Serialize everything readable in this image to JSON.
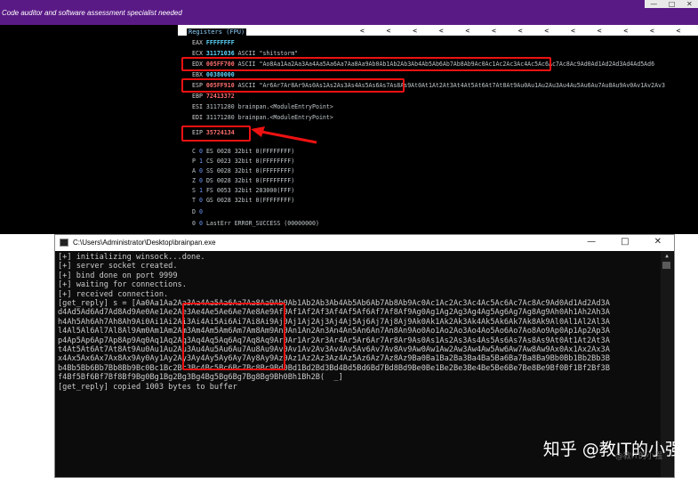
{
  "banner": {
    "title": "Code auditor and software assessment specialist needed",
    "controls": [
      "—",
      "□",
      "✕"
    ]
  },
  "registers": {
    "header": "Registers (FPU)",
    "arrows": "< < < < < < < < < < < < < < < < < < <",
    "rows": [
      {
        "name": "EAX",
        "value": "FFFFFFFF",
        "comment": ""
      },
      {
        "name": "ECX",
        "value": "31171036",
        "comment": "ASCII \"shitstorm\""
      },
      {
        "name": "EDX",
        "value": "005FF700",
        "comment": "ASCII \"Ao8Aa1Aa2Aa3Aa4Aa5Aa6Aa7Aa8Aa9Ab0Ab1Ab2Ab3Ab4Ab5Ab6Ab7Ab8Ab9Ac0Ac1Ac2Ac3Ac4Ac5Ac6Ac7Ac8Ac9Ad0Ad1Ad2Ad3Ad4Ad5Ad6"
      },
      {
        "name": "EBX",
        "value": "00380000",
        "comment": ""
      },
      {
        "name": "ESP",
        "value": "005FF910",
        "comment": "ASCII \"Ar6Ar7Ar8Ar9As0As1As2As3As4As5As6As7As8As9At0At1At2At3At4At5At6At7At8At9Au0Au1Au2Au3Au4Au5Au6Au7Au8Au9Av0Av1Av2Av3"
      },
      {
        "name": "EBP",
        "value": "72413372",
        "comment": ""
      },
      {
        "name": "ESI",
        "value": "31171280",
        "comment": "brainpan.<ModuleEntryPoint>"
      },
      {
        "name": "EDI",
        "value": "31171280",
        "comment": "brainpan.<ModuleEntryPoint>"
      },
      {
        "name": "EIP",
        "value": "35724134",
        "comment": ""
      }
    ],
    "flags": [
      {
        "f": "C",
        "v": "0",
        "seg": "ES 0028 32bit 0(FFFFFFFF)"
      },
      {
        "f": "P",
        "v": "1",
        "seg": "CS 0023 32bit 0(FFFFFFFF)"
      },
      {
        "f": "A",
        "v": "0",
        "seg": "SS 0028 32bit 0(FFFFFFFF)"
      },
      {
        "f": "Z",
        "v": "0",
        "seg": "DS 0028 32bit 0(FFFFFFFF)"
      },
      {
        "f": "S",
        "v": "1",
        "seg": "FS 0053 32bit 283000(FFF)"
      },
      {
        "f": "T",
        "v": "0",
        "seg": "GS 0028 32bit 0(FFFFFFFF)"
      },
      {
        "f": "D",
        "v": "0",
        "seg": ""
      },
      {
        "f": "0",
        "v": "0",
        "seg": "LastErr ERROR_SUCCESS (00000000)"
      }
    ]
  },
  "console": {
    "path": "C:\\Users\\Administrator\\Desktop\\brainpan.exe",
    "buttons": [
      "—",
      "□",
      "✕"
    ],
    "lines": [
      "[+] initializing winsock...done.",
      "[+] server socket created.",
      "[+] bind done on port 9999",
      "[+] waiting for connections.",
      "[+] received connection.",
      "[get_reply] s = [Aa0Aa1Aa2Aa3Aa4Aa5Aa6Aa7Aa8Aa9Ab0Ab1Ab2Ab3Ab4Ab5Ab6Ab7Ab8Ab9Ac0Ac1Ac2Ac3Ac4Ac5Ac6Ac7Ac8Ac9Ad0Ad1Ad2Ad3A",
      "d4Ad5Ad6Ad7Ad8Ad9Ae0Ae1Ae2Ae3Ae4Ae5Ae6Ae7Ae8Ae9Af0Af1Af2Af3Af4Af5Af6Af7Af8Af9Ag0Ag1Ag2Ag3Ag4Ag5Ag6Ag7Ag8Ag9Ah0Ah1Ah2Ah3A",
      "h4Ah5Ah6Ah7Ah8Ah9Ai0Ai1Ai2Ai3Ai4Ai5Ai6Ai7Ai8Ai9Aj0Aj1Aj2Aj3Aj4Aj5Aj6Aj7Aj8Aj9Ak0Ak1Ak2Ak3Ak4Ak5Ak6Ak7Ak8Ak9Al0Al1Al2Al3A",
      "l4Al5Al6Al7Al8Al9Am0Am1Am2Am3Am4Am5Am6Am7Am8Am9An0An1An2An3An4An5An6An7An8An9Ao0Ao1Ao2Ao3Ao4Ao5Ao6Ao7Ao8Ao9Ap0Ap1Ap2Ap3A",
      "p4Ap5Ap6Ap7Ap8Ap9Aq0Aq1Aq2Aq3Aq4Aq5Aq6Aq7Aq8Aq9Ar0Ar1Ar2Ar3Ar4Ar5Ar6Ar7Ar8Ar9As0As1As2As3As4As5As6As7As8As9At0At1At2At3A",
      "t4At5At6At7At8At9Au0Au1Au2Au3Au4Au5Au6Au7Au8Au9Av0Av1Av2Av3Av4Av5Av6Av7Av8Av9Aw0Aw1Aw2Aw3Aw4Aw5Aw6Aw7Aw8Aw9Ax0Ax1Ax2Ax3A",
      "x4Ax5Ax6Ax7Ax8Ax9Ay0Ay1Ay2Ay3Ay4Ay5Ay6Ay7Ay8Ay9Az0Az1Az2Az3Az4Az5Az6Az7Az8Az9Ba0Ba1Ba2Ba3Ba4Ba5Ba6Ba7Ba8Ba9Bb0Bb1Bb2Bb3B",
      "b4Bb5Bb6Bb7Bb8Bb9Bc0Bc1Bc2Bc3Bc4Bc5Bc6Bc7Bc8Bc9Bd0Bd1Bd2Bd3Bd4Bd5Bd6Bd7Bd8Bd9Be0Be1Be2Be3Be4Be5Be6Be7Be8Be9Bf0Bf1Bf2Bf3B",
      "f4Bf5Bf6Bf7Bf8Bf9Bg0Bg1Bg2Bg3Bg4Bg5Bg6Bg7Bg8Bg9Bh0Bh1Bh2B(  _]",
      "[get_reply] copied 1003 bytes to buffer"
    ]
  },
  "watermark": {
    "text": "知乎 @教IT的小强",
    "sub": "@教IT的小强"
  }
}
